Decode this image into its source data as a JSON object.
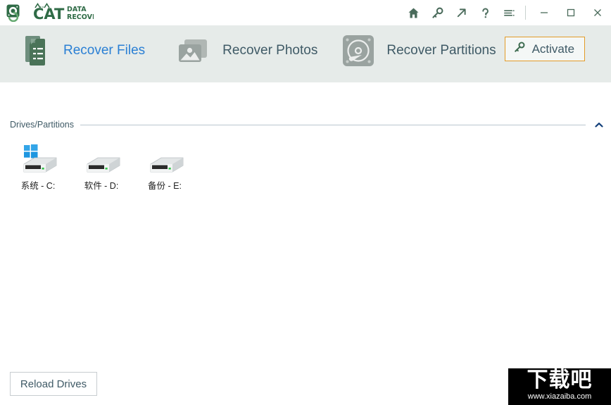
{
  "app": {
    "brand_name": "CAT",
    "brand_line1": "DATA",
    "brand_line2": "RECOVERY",
    "accent_green": "#3d6b4f",
    "accent_blue": "#2a7fd4",
    "accent_orange": "#e39b27",
    "tabstrip_bg": "#e6ebe9"
  },
  "titlebar": {
    "icons": [
      {
        "name": "home-icon",
        "title": "Home"
      },
      {
        "name": "key-icon",
        "title": "Activate"
      },
      {
        "name": "arrow-up-right-icon",
        "title": "Upgrade"
      },
      {
        "name": "question-mark-icon",
        "title": "Help"
      },
      {
        "name": "menu-list-icon",
        "title": "Menu"
      }
    ],
    "window_controls": [
      {
        "name": "minimize-button",
        "glyph": "─"
      },
      {
        "name": "maximize-button",
        "glyph": "□"
      },
      {
        "name": "close-button",
        "glyph": "✕"
      }
    ]
  },
  "tabs": [
    {
      "id": "recover-files",
      "label": "Recover Files",
      "icon": "documents-icon",
      "active": true
    },
    {
      "id": "recover-photos",
      "label": "Recover Photos",
      "icon": "photos-icon",
      "active": false
    },
    {
      "id": "recover-partitions",
      "label": "Recover Partitions",
      "icon": "hard-disk-icon",
      "active": false
    }
  ],
  "activate": {
    "label": "Activate",
    "icon": "key-icon"
  },
  "section": {
    "title": "Drives/Partitions",
    "collapse_icon": "chevron-up-icon"
  },
  "drives": [
    {
      "label": "系统 - C:",
      "os_badge": true,
      "badge": "windows-logo"
    },
    {
      "label": "软件 - D:",
      "os_badge": false
    },
    {
      "label": "备份 - E:",
      "os_badge": false
    }
  ],
  "footer": {
    "reload_label": "Reload Drives"
  },
  "watermark": {
    "cn_text": "下载吧",
    "url": "www.xiazaiba.com"
  }
}
